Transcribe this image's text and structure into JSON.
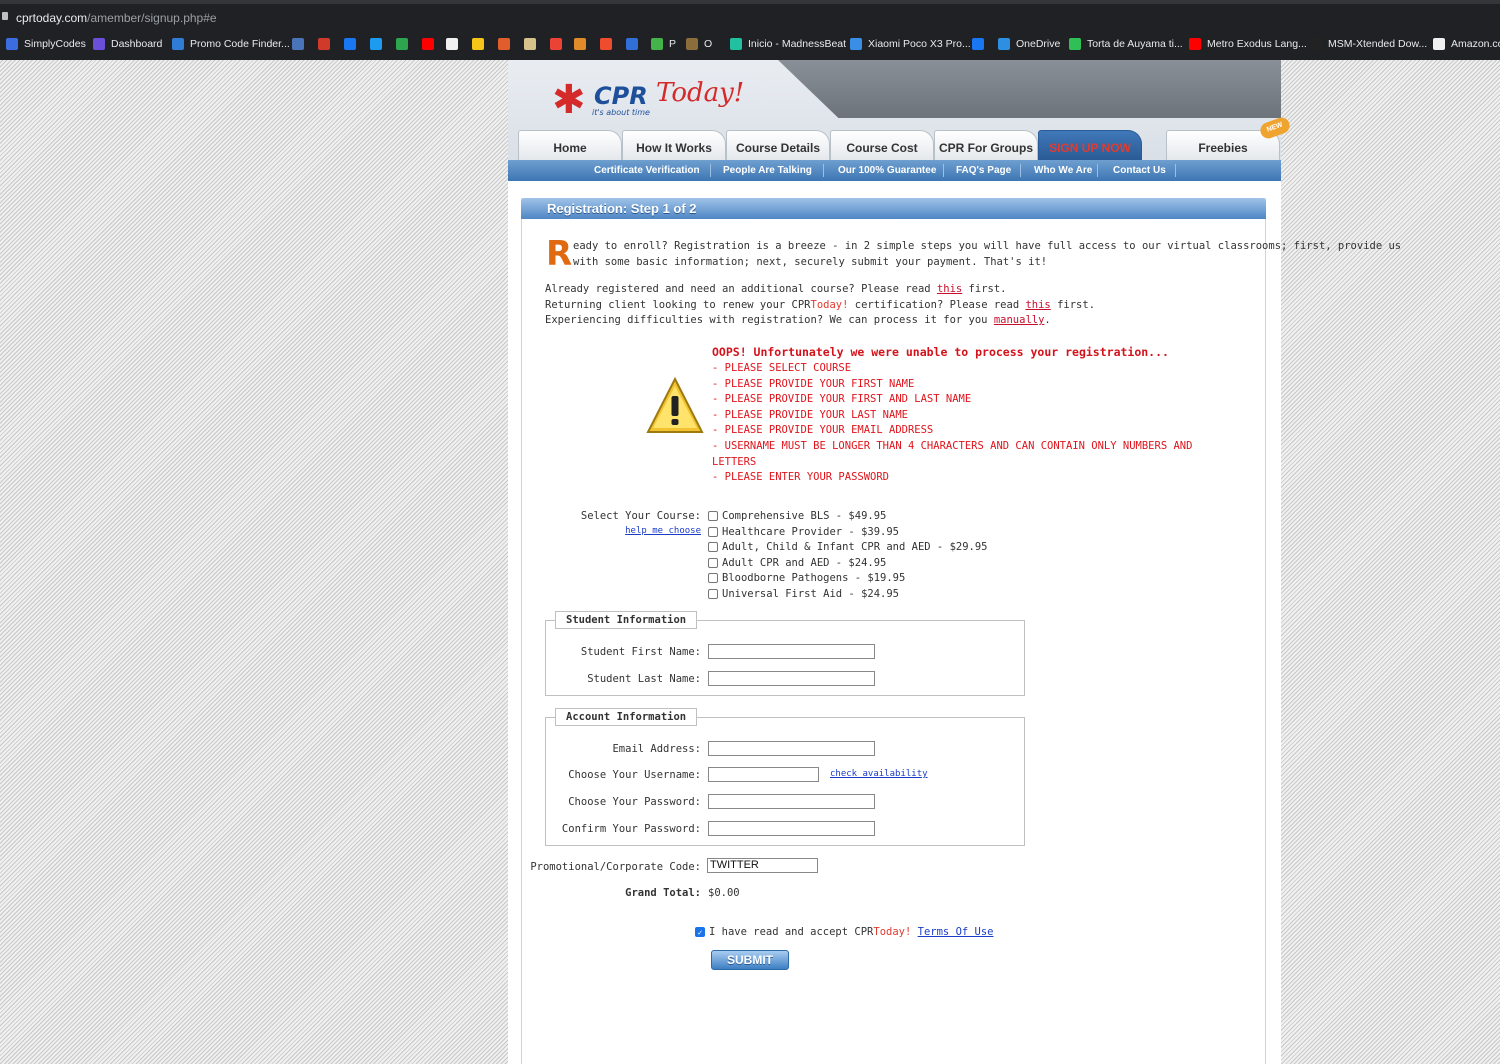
{
  "browser": {
    "url_host": "cprtoday.com",
    "url_path": "/amember/signup.php#e",
    "bookmarks": [
      {
        "label": "SimplyCodes",
        "color": "#3b6de0"
      },
      {
        "label": "Dashboard",
        "color": "#6b4fd8"
      },
      {
        "label": "Promo Code Finder...",
        "color": "#2f7bd6"
      },
      {
        "label": "",
        "color": "#4a74b8"
      },
      {
        "label": "",
        "color": "#d03a2b"
      },
      {
        "label": "",
        "color": "#1877f2"
      },
      {
        "label": "",
        "color": "#1d9bf0"
      },
      {
        "label": "",
        "color": "#2da44e"
      },
      {
        "label": "",
        "color": "#ff0000"
      },
      {
        "label": "",
        "color": "#f0f0f0"
      },
      {
        "label": "",
        "color": "#f5c518"
      },
      {
        "label": "",
        "color": "#e25d2c"
      },
      {
        "label": "",
        "color": "#d6c28a"
      },
      {
        "label": "",
        "color": "#ea4335"
      },
      {
        "label": "",
        "color": "#e08a2a"
      },
      {
        "label": "",
        "color": "#ee4d2d"
      },
      {
        "label": "",
        "color": "#2f6fd6"
      },
      {
        "label": "P",
        "color": "#44b34a"
      },
      {
        "label": "O",
        "color": "#8a6d3b"
      },
      {
        "label": "Inicio - MadnessBeat",
        "color": "#20c0a0"
      },
      {
        "label": "Xiaomi Poco X3 Pro...",
        "color": "#3a8ee6"
      },
      {
        "label": "",
        "color": "#1877f2"
      },
      {
        "label": "OneDrive",
        "color": "#2e8fe0"
      },
      {
        "label": "Torta de Auyama ti...",
        "color": "#2fbf55"
      },
      {
        "label": "Metro Exodus Lang...",
        "color": "#ff0000"
      },
      {
        "label": "MSM-Xtended Dow...",
        "color": "#222222"
      },
      {
        "label": "Amazon.co",
        "color": "#f0f0f0"
      }
    ]
  },
  "logo": {
    "brand": "CPR",
    "brand_script": "Today!",
    "tagline": "it's about time"
  },
  "nav": {
    "tabs": [
      {
        "label": "Home",
        "active": false
      },
      {
        "label": "How It Works",
        "active": false
      },
      {
        "label": "Course Details",
        "active": false
      },
      {
        "label": "Course Cost",
        "active": false
      },
      {
        "label": "CPR For Groups",
        "active": false
      },
      {
        "label": "SIGN UP NOW",
        "active": true
      },
      {
        "label": "Freebies",
        "active": false
      }
    ],
    "new_badge": "NEW",
    "subnav": [
      "Certificate Verification",
      "People Are Talking",
      "Our 100% Guarantee",
      "FAQ's Page",
      "Who We Are",
      "Contact Us"
    ]
  },
  "step": {
    "title": "Registration: Step 1 of 2"
  },
  "intro": {
    "dropcap": "R",
    "line1": "eady to enroll? Registration is a breeze - in 2 simple steps you will have full access to our virtual classrooms; first, provide us",
    "line2": "with some basic information; next, securely submit your payment. That's it!",
    "already_pre": "Already registered and need an additional course? Please read ",
    "already_link": "this",
    "already_post": " first.",
    "returning_pre": "Returning client looking to renew your CPR",
    "returning_today": "Today!",
    "returning_mid": " certification? Please read ",
    "returning_link": "this",
    "returning_post": " first.",
    "difficult_pre": "Experiencing difficulties with registration? We can process it for you ",
    "difficult_link": "manually",
    "difficult_post": "."
  },
  "errors": {
    "title": "OOPS! Unfortunately we were unable to process your registration...",
    "items": [
      "- PLEASE SELECT COURSE",
      "- PLEASE PROVIDE YOUR FIRST NAME",
      "- PLEASE PROVIDE YOUR FIRST AND LAST NAME",
      "- PLEASE PROVIDE YOUR LAST NAME",
      "- PLEASE PROVIDE YOUR EMAIL ADDRESS",
      "- USERNAME MUST BE LONGER THAN 4 CHARACTERS AND CAN CONTAIN ONLY NUMBERS AND",
      "LETTERS",
      "- PLEASE ENTER YOUR PASSWORD"
    ]
  },
  "course": {
    "label": "Select Your Course:",
    "help_link": "help me choose",
    "options": [
      {
        "label": "Comprehensive BLS - $49.95",
        "checked": false
      },
      {
        "label": "Healthcare Provider - $39.95",
        "checked": false
      },
      {
        "label": "Adult, Child & Infant CPR and AED - $29.95",
        "checked": false
      },
      {
        "label": "Adult CPR and AED - $24.95",
        "checked": false
      },
      {
        "label": "Bloodborne Pathogens - $19.95",
        "checked": false
      },
      {
        "label": "Universal First Aid - $24.95",
        "checked": false
      }
    ]
  },
  "student": {
    "legend": "Student Information",
    "first_name_label": "Student First Name:",
    "first_name_value": "",
    "last_name_label": "Student Last Name:",
    "last_name_value": ""
  },
  "account": {
    "legend": "Account Information",
    "email_label": "Email Address:",
    "email_value": "",
    "username_label": "Choose Your Username:",
    "username_value": "",
    "check_link": "check availability",
    "password_label": "Choose Your Password:",
    "password_value": "",
    "confirm_label": "Confirm Your Password:",
    "confirm_value": ""
  },
  "promo": {
    "label": "Promotional/Corporate Code:",
    "value": "TWITTER"
  },
  "total": {
    "label": "Grand Total:",
    "value": "$0.00"
  },
  "terms": {
    "checked": true,
    "pre": "I have read and accept CPR",
    "today": "Today!",
    "link": "Terms Of Use"
  },
  "submit_label": "SUBMIT"
}
